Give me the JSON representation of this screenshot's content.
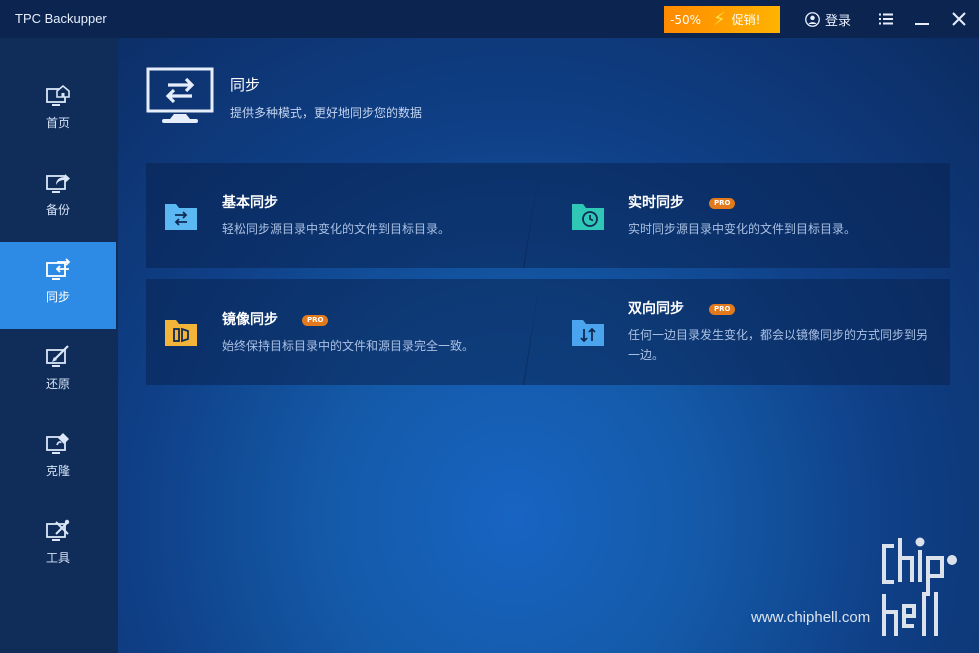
{
  "app": {
    "title": "TPC Backupper"
  },
  "titlebar": {
    "promo_percent": "-50%",
    "promo_label": "促销!",
    "login_label": "登录",
    "menu_icon": "list-menu-icon",
    "minimize_icon": "minimize-icon",
    "close_icon": "close-icon"
  },
  "sidebar": {
    "items": [
      {
        "label": "首页",
        "icon": "home-monitor-icon",
        "active": false
      },
      {
        "label": "备份",
        "icon": "backup-monitor-icon",
        "active": false
      },
      {
        "label": "同步",
        "icon": "sync-monitor-icon",
        "active": true
      },
      {
        "label": "还原",
        "icon": "restore-monitor-icon",
        "active": false
      },
      {
        "label": "克隆",
        "icon": "clone-monitor-icon",
        "active": false
      },
      {
        "label": "工具",
        "icon": "tools-monitor-icon",
        "active": false
      }
    ]
  },
  "header": {
    "title": "同步",
    "description": "提供多种模式，更好地同步您的数据",
    "icon": "sync-monitor-large-icon"
  },
  "cards": [
    {
      "title": "基本同步",
      "description": "轻松同步源目录中变化的文件到目标目录。",
      "pro": false,
      "icon": "basic-sync-folder-icon",
      "icon_color": "#5cb8f2"
    },
    {
      "title": "实时同步",
      "description": "实时同步源目录中变化的文件到目标目录。",
      "pro": true,
      "badge": "PRO",
      "icon": "realtime-sync-folder-icon",
      "icon_color": "#2fc7b5"
    },
    {
      "title": "镜像同步",
      "description": "始终保持目标目录中的文件和源目录完全一致。",
      "pro": true,
      "badge": "PRO",
      "icon": "mirror-sync-folder-icon",
      "icon_color": "#f2b53a"
    },
    {
      "title": "双向同步",
      "description": "任何一边目录发生变化，都会以镜像同步的方式同步到另一边。",
      "pro": true,
      "badge": "PRO",
      "icon": "two-way-sync-folder-icon",
      "icon_color": "#4aa5ee"
    }
  ],
  "watermark": {
    "site": "www.chiphell.com"
  },
  "colors": {
    "accent": "#2e8be5",
    "pro_badge": "#e27a1d",
    "promo": "#ff9a00"
  }
}
